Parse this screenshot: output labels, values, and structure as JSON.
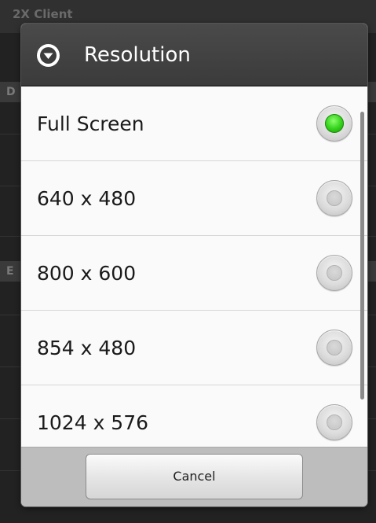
{
  "background_app": {
    "title": "2X Client",
    "section_1_label": "D",
    "section_2_label": "E"
  },
  "dialog": {
    "title": "Resolution",
    "header_icon": "chevron-down-circle-icon",
    "options": [
      {
        "label": "Full Screen",
        "selected": true
      },
      {
        "label": "640 x 480",
        "selected": false
      },
      {
        "label": "800 x 600",
        "selected": false
      },
      {
        "label": "854 x 480",
        "selected": false
      },
      {
        "label": "1024 x 576",
        "selected": false
      }
    ],
    "cancel_label": "Cancel"
  },
  "colors": {
    "header_bg": "#3f3f3f",
    "list_bg": "#fafafa",
    "selected_radio": "#33d11a",
    "footer_bg": "#bdbdbd"
  }
}
